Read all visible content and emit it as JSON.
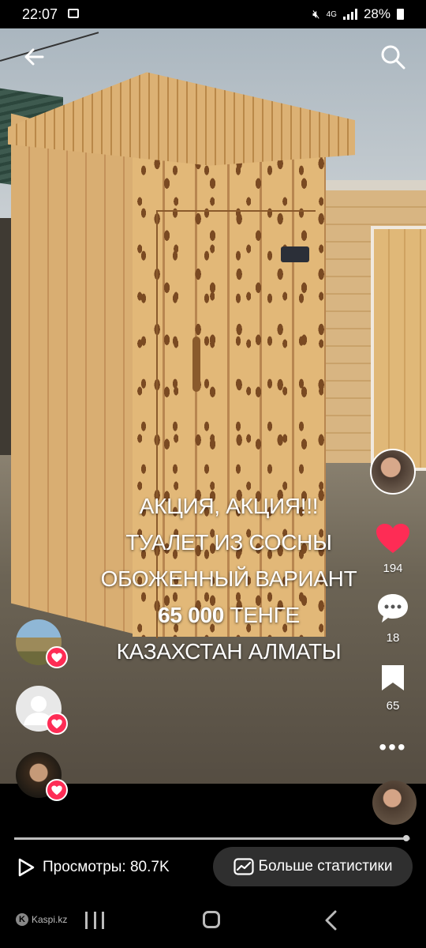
{
  "status_bar": {
    "time": "22:07",
    "network": "4G",
    "battery": "28%",
    "icons": [
      "gallery-icon",
      "mute-icon",
      "signal-icon",
      "battery-icon"
    ]
  },
  "top_controls": {
    "back_icon": "arrow-left-icon",
    "search_icon": "search-icon"
  },
  "video": {
    "caption_lines": [
      "АКЦИЯ, АКЦИЯ!!!",
      "ТУАЛЕТ ИЗ СОСНЫ",
      "ОБОЖЕННЫЙ ВАРИАНТ"
    ],
    "price_bold": "65 000",
    "price_rest": " ТЕНГЕ",
    "location": "КАЗАХСТАН АЛМАТЫ"
  },
  "rail": {
    "likes": "194",
    "comments": "18",
    "saves": "65",
    "like_color": "#fe2c55"
  },
  "likers": {
    "badge_color": "#fe2c55"
  },
  "footer": {
    "views_label": "Просмотры: 80.7K",
    "stats_button": "Больше статистики",
    "progress": 0.99,
    "watermark": "Kaspi.kz"
  }
}
